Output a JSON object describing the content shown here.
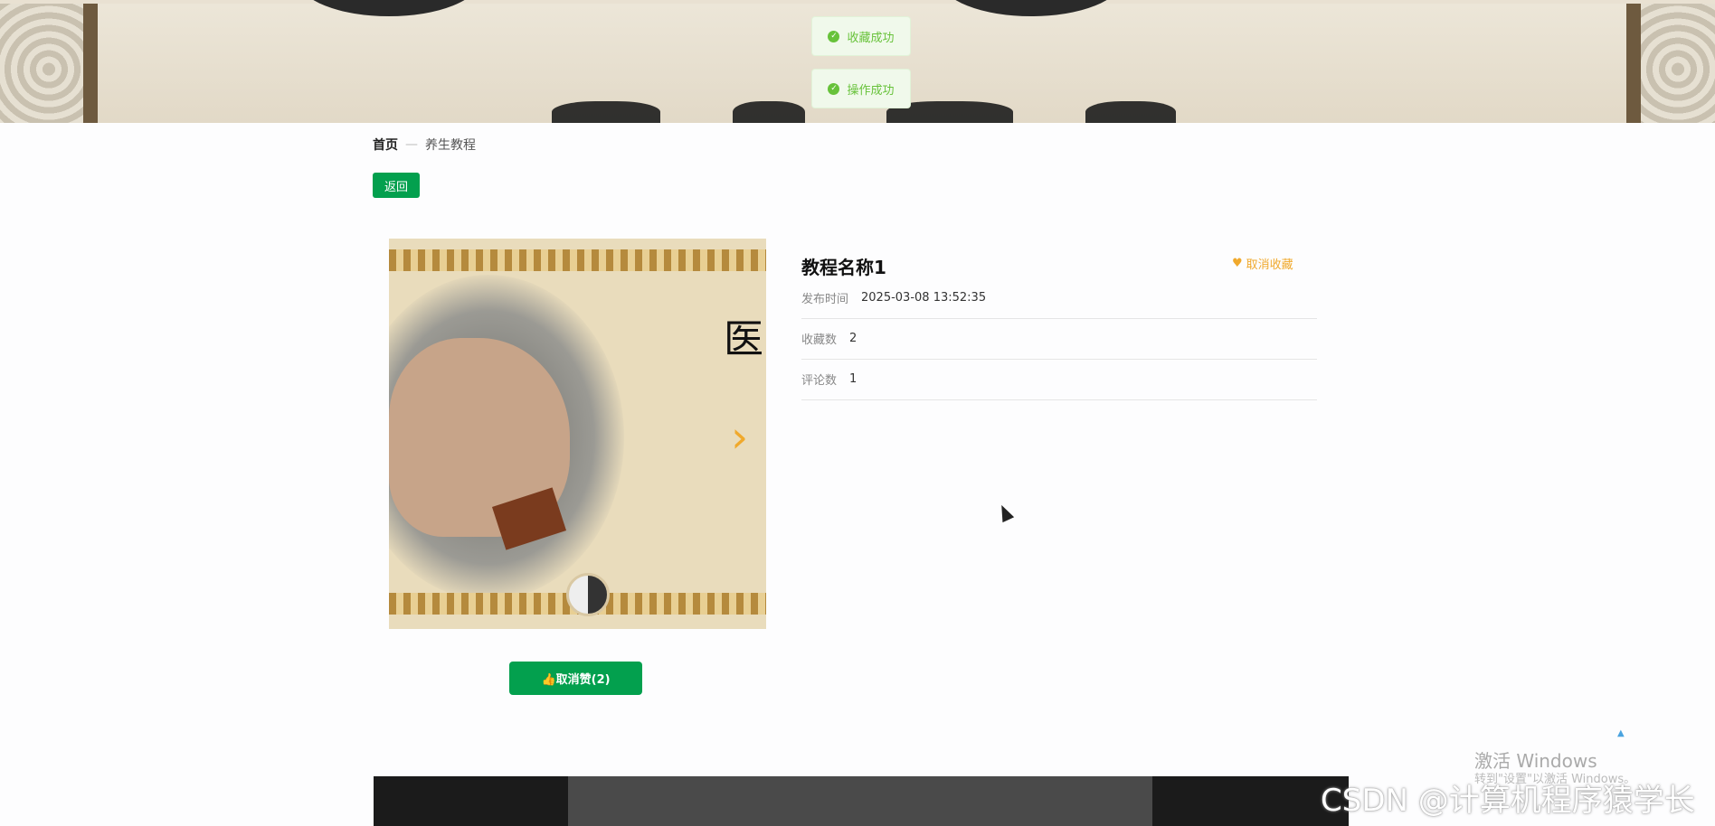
{
  "toasts": [
    {
      "text": "收藏成功"
    },
    {
      "text": "操作成功"
    }
  ],
  "breadcrumb": {
    "home": "首页",
    "separator": "—",
    "current": "养生教程"
  },
  "back_label": "返回",
  "photo": {
    "character": "医"
  },
  "detail": {
    "title": "教程名称1",
    "fav_label": "取消收藏",
    "rows": [
      {
        "key": "发布时间",
        "value": "2025-03-08 13:52:35"
      },
      {
        "key": "收藏数",
        "value": "2"
      },
      {
        "key": "评论数",
        "value": "1"
      }
    ]
  },
  "like_label": "取消赞(2)",
  "watermarks": {
    "activate": "激活 Windows",
    "activate_sub": "转到\"设置\"以激活 Windows。",
    "csdn": "CSDN @计算机程序猿学长"
  },
  "colors": {
    "primary": "#03a04e",
    "accent": "#f0a92c",
    "toast_text": "#67c23a"
  }
}
